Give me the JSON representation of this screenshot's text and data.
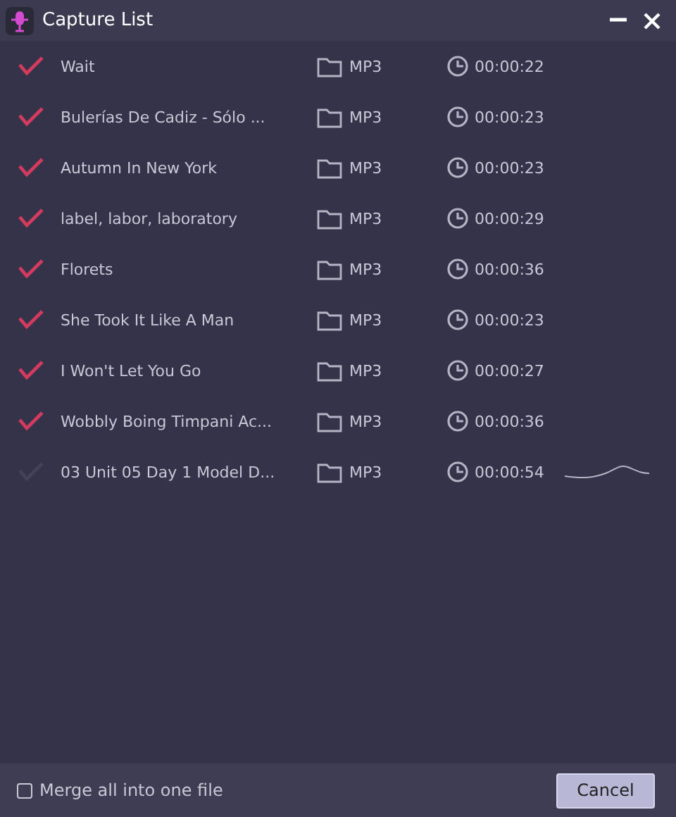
{
  "window": {
    "title": "Capture List"
  },
  "rows": [
    {
      "name": "Wait",
      "checked": true,
      "format": "MP3",
      "duration": "00:00:22",
      "recording": false
    },
    {
      "name": "Bulerías De Cadiz - Sólo ...",
      "checked": true,
      "format": "MP3",
      "duration": "00:00:23",
      "recording": false
    },
    {
      "name": "Autumn In New York",
      "checked": true,
      "format": "MP3",
      "duration": "00:00:23",
      "recording": false
    },
    {
      "name": "label, labor, laboratory",
      "checked": true,
      "format": "MP3",
      "duration": "00:00:29",
      "recording": false
    },
    {
      "name": "Florets",
      "checked": true,
      "format": "MP3",
      "duration": "00:00:36",
      "recording": false
    },
    {
      "name": "She Took It Like A Man",
      "checked": true,
      "format": "MP3",
      "duration": "00:00:23",
      "recording": false
    },
    {
      "name": "I Won't Let You Go",
      "checked": true,
      "format": "MP3",
      "duration": "00:00:27",
      "recording": false
    },
    {
      "name": "Wobbly Boing Timpani Ac...",
      "checked": true,
      "format": "MP3",
      "duration": "00:00:36",
      "recording": false
    },
    {
      "name": "03 Unit 05 Day 1 Model D...",
      "checked": false,
      "format": "MP3",
      "duration": "00:00:54",
      "recording": true
    }
  ],
  "footer": {
    "merge": {
      "label": "Merge all into one file",
      "checked": false
    },
    "cancel": "Cancel"
  }
}
